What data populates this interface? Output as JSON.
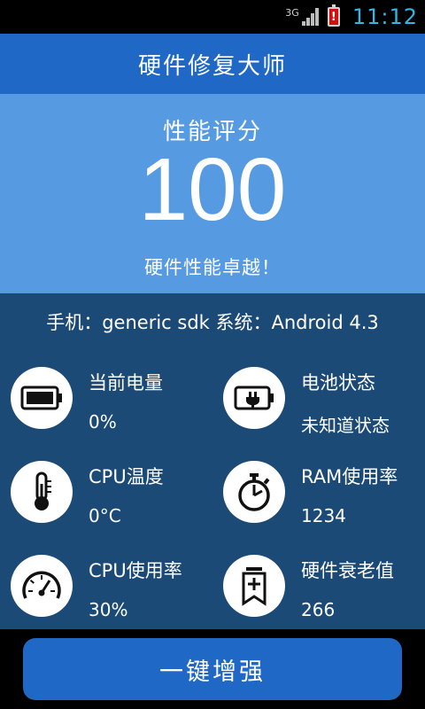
{
  "status_bar": {
    "network": "3G",
    "battery_alert": "!",
    "time": "11:12"
  },
  "app": {
    "title": "硬件修复大师"
  },
  "score": {
    "label": "性能评分",
    "value": "100",
    "description": "硬件性能卓越！"
  },
  "device": {
    "info": "手机：generic sdk  系统：Android 4.3"
  },
  "stats": [
    {
      "icon": "battery-icon",
      "label": "当前电量",
      "value": "0%"
    },
    {
      "icon": "battery-plug-icon",
      "label": "电池状态",
      "value": "未知道状态"
    },
    {
      "icon": "thermometer-icon",
      "label": "CPU温度",
      "value": "0°C"
    },
    {
      "icon": "stopwatch-icon",
      "label": "RAM使用率",
      "value": "1234"
    },
    {
      "icon": "gauge-icon",
      "label": "CPU使用率",
      "value": "30%"
    },
    {
      "icon": "bookmark-plus-icon",
      "label": "硬件衰老值",
      "value": "266"
    }
  ],
  "action": {
    "label": "一键增强"
  },
  "colors": {
    "title_bar": "#1f68c6",
    "score_panel": "#569ae2",
    "body": "#1c4a77",
    "clock": "#33b5e5"
  }
}
